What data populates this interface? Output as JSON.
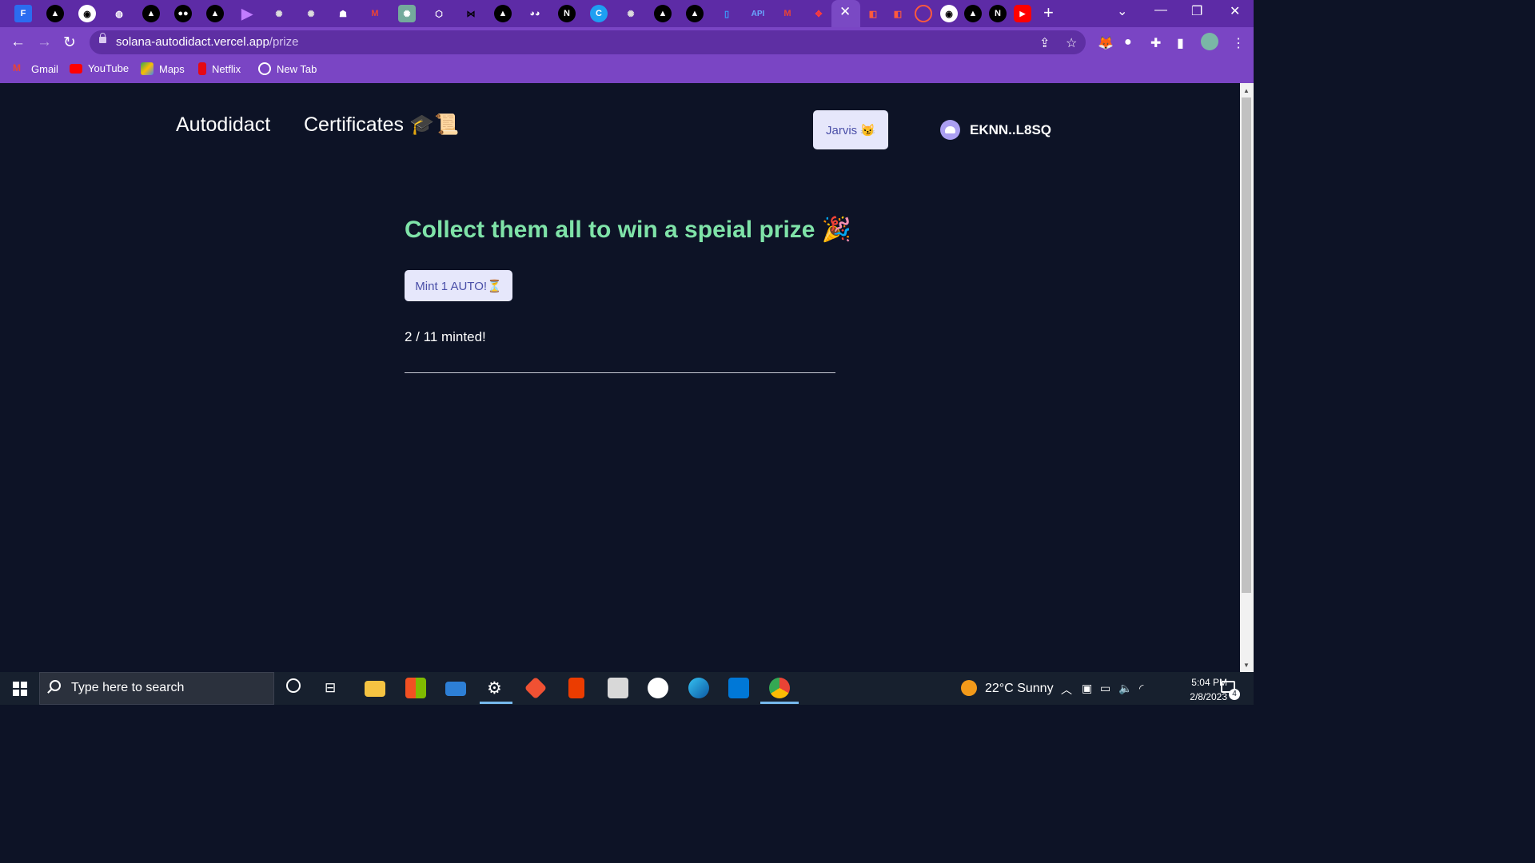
{
  "browser": {
    "url_host": "solana-autodidact.vercel.app",
    "url_path": "/prize",
    "bookmarks": [
      {
        "label": "Gmail",
        "icon": "gmail-icon",
        "color": "#ea4335"
      },
      {
        "label": "YouTube",
        "icon": "youtube-icon",
        "color": "#ff0000"
      },
      {
        "label": "Maps",
        "icon": "maps-icon",
        "color": "#34a853"
      },
      {
        "label": "Netflix",
        "icon": "netflix-icon",
        "color": "#e50914"
      },
      {
        "label": "New Tab",
        "icon": "globe-icon",
        "color": "#ffffff"
      }
    ],
    "tabs_icon_text": {
      "api": "API"
    }
  },
  "nav": {
    "brand": "Autodidact",
    "certificates": "Certificates 🎓📜",
    "jarvis_button": "Jarvis 😼",
    "wallet_address": "EKNN..L8SQ"
  },
  "main": {
    "headline": "Collect them all to win a speial prize 🎉",
    "mint_button": "Mint 1 AUTO!⏳",
    "minted_status": "2 / 11 minted!"
  },
  "taskbar": {
    "search_placeholder": "Type here to search",
    "weather": "22°C  Sunny",
    "time": "5:04 PM",
    "date": "2/8/2023",
    "notification_count": "4"
  },
  "colors": {
    "headline": "#7fe3a8",
    "page_background": "#0d1326",
    "chrome_purple": "#7a45c4",
    "button_bg": "#e6e7fb",
    "button_text": "#4a4fa8"
  }
}
